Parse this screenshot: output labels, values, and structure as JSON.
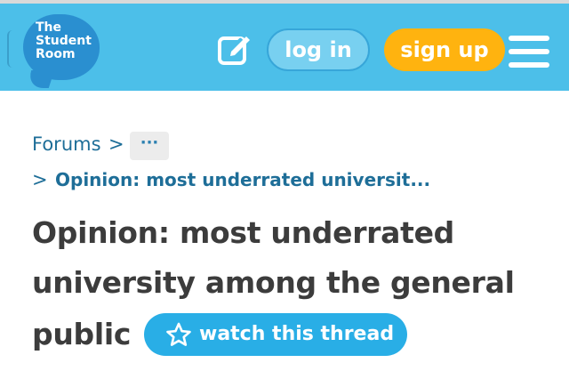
{
  "header": {
    "logo_text": "The\nStudent\nRoom",
    "edit_icon": "pencil-square-icon",
    "login_label": "log in",
    "signup_label": "sign up",
    "menu_icon": "hamburger-menu-icon",
    "colors": {
      "bar": "#4cbfe9",
      "logo": "#2a8fd0",
      "signup": "#ffb30f"
    }
  },
  "breadcrumb": {
    "root": "Forums",
    "separator": ">",
    "more": "···",
    "current": "Opinion: most underrated universit..."
  },
  "thread": {
    "title_lines": [
      "Opinion: most underrated",
      "university among the general",
      "public"
    ],
    "watch_label": "watch this thread",
    "watch_icon": "star-outline-icon",
    "colors": {
      "watch": "#29aee6",
      "title": "#3c3c3c"
    }
  }
}
